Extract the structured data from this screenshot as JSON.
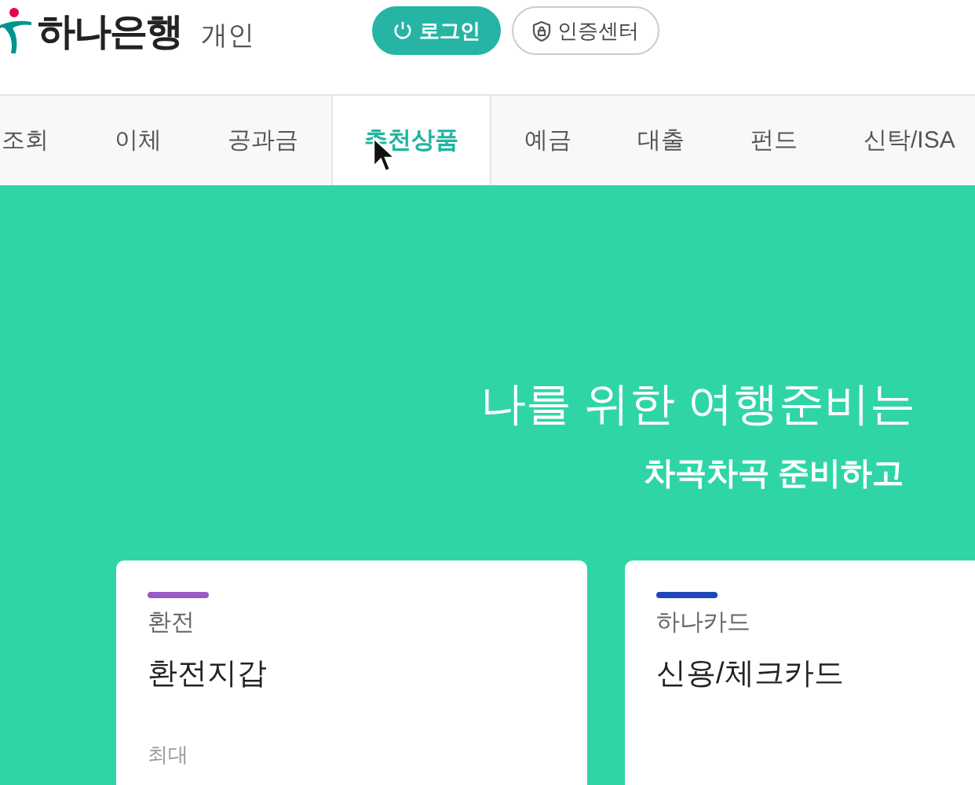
{
  "header": {
    "logo": "하나은행",
    "section": "개인",
    "buttons": [
      {
        "label": "로그인",
        "kind": "primary"
      },
      {
        "label": "인증센터",
        "kind": "outline"
      }
    ]
  },
  "nav": [
    {
      "label": "조회",
      "selected": false
    },
    {
      "label": "이체",
      "selected": false
    },
    {
      "label": "공과금",
      "selected": false
    },
    {
      "label": "추천상품",
      "selected": true
    },
    {
      "label": "예금",
      "selected": false
    },
    {
      "label": "대출",
      "selected": false
    },
    {
      "label": "펀드",
      "selected": false
    },
    {
      "label": "신탁/ISA",
      "selected": false
    }
  ],
  "banner": {
    "title": "나를 위한 여행준비는",
    "subtitle": "차곡차곡 준비하고"
  },
  "cards": [
    {
      "category": "환전",
      "name": "환전지갑",
      "color": "#9b59c8",
      "detail": "최대"
    },
    {
      "category": "하나카드",
      "name": "신용/체크카드",
      "color": "#1f47b8"
    }
  ]
}
